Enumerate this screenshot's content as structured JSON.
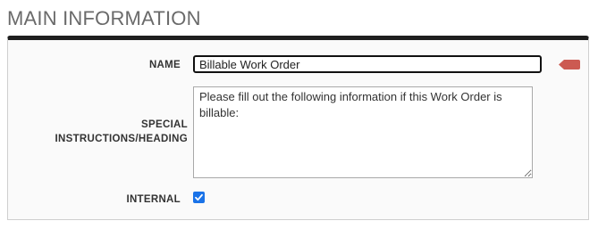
{
  "section": {
    "title": "MAIN INFORMATION"
  },
  "form": {
    "name": {
      "label": "NAME",
      "value": "Billable Work Order"
    },
    "special_instructions": {
      "label": "SPECIAL INSTRUCTIONS/HEADING",
      "value": "Please fill out the following information if this Work Order is billable:"
    },
    "internal": {
      "label": "INTERNAL",
      "checked": true
    }
  },
  "icons": {
    "required_flag": "required-flag-icon",
    "checkmark": "checkmark-icon"
  },
  "colors": {
    "required_flag": "#cc5a52",
    "checkbox_accent": "#1a73e8",
    "panel_top_border": "#1f1f1f"
  }
}
